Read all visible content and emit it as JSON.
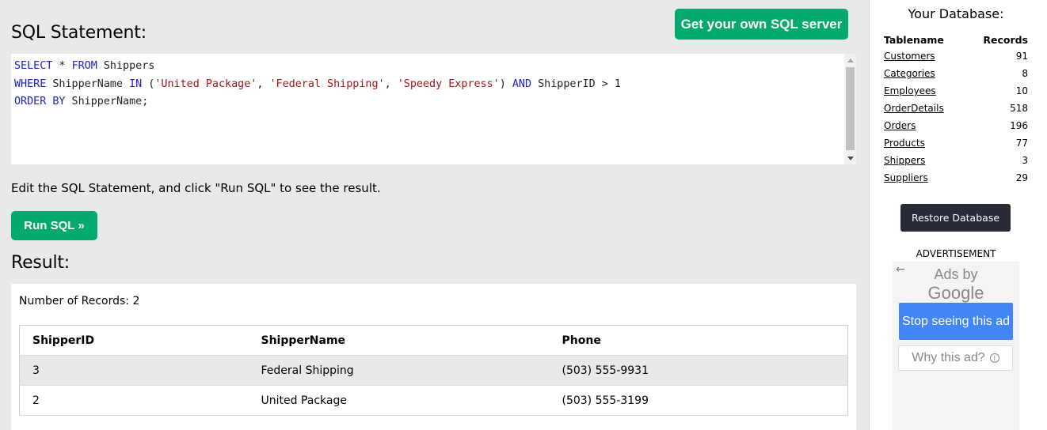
{
  "header": {
    "title": "SQL Statement:",
    "get_server_label": "Get your own SQL server"
  },
  "editor": {
    "lines": [
      [
        {
          "t": "SELECT",
          "c": "kw"
        },
        {
          "t": " * ",
          "c": ""
        },
        {
          "t": "FROM",
          "c": "kw"
        },
        {
          "t": " Shippers",
          "c": ""
        }
      ],
      [
        {
          "t": "WHERE",
          "c": "kw"
        },
        {
          "t": " ShipperName ",
          "c": ""
        },
        {
          "t": "IN",
          "c": "kw"
        },
        {
          "t": " (",
          "c": ""
        },
        {
          "t": "'United Package'",
          "c": "str"
        },
        {
          "t": ", ",
          "c": ""
        },
        {
          "t": "'Federal Shipping'",
          "c": "str"
        },
        {
          "t": ", ",
          "c": ""
        },
        {
          "t": "'Speedy Express'",
          "c": "str"
        },
        {
          "t": ") ",
          "c": ""
        },
        {
          "t": "AND",
          "c": "kw"
        },
        {
          "t": " ShipperID > 1",
          "c": ""
        }
      ],
      [
        {
          "t": "ORDER BY",
          "c": "kw"
        },
        {
          "t": " ShipperName;",
          "c": ""
        }
      ]
    ]
  },
  "instruction": "Edit the SQL Statement, and click \"Run SQL\" to see the result.",
  "run_label": "Run SQL »",
  "result": {
    "title": "Result:",
    "record_count": "Number of Records: 2",
    "columns": [
      "ShipperID",
      "ShipperName",
      "Phone"
    ],
    "rows": [
      [
        "3",
        "Federal Shipping",
        "(503) 555-9931"
      ],
      [
        "2",
        "United Package",
        "(503) 555-3199"
      ]
    ]
  },
  "sidebar": {
    "title": "Your Database:",
    "col_table": "Tablename",
    "col_records": "Records",
    "tables": [
      {
        "name": "Customers",
        "records": "91"
      },
      {
        "name": "Categories",
        "records": "8"
      },
      {
        "name": "Employees",
        "records": "10"
      },
      {
        "name": "OrderDetails",
        "records": "518"
      },
      {
        "name": "Orders",
        "records": "196"
      },
      {
        "name": "Products",
        "records": "77"
      },
      {
        "name": "Shippers",
        "records": "3"
      },
      {
        "name": "Suppliers",
        "records": "29"
      }
    ],
    "restore_label": "Restore Database",
    "ad_label": "ADVERTISEMENT"
  },
  "ad": {
    "ads_by": "Ads by",
    "google": "Google",
    "stop_label": "Stop seeing this ad",
    "why_label": "Why this ad?",
    "back_icon": "back-arrow-icon",
    "info_icon": "info-icon"
  },
  "colors": {
    "accent_green": "#04aa6d",
    "restore_dark": "#282a35",
    "ad_blue": "#4285f4",
    "keyword": "#1f21c8",
    "string": "#a31515"
  }
}
